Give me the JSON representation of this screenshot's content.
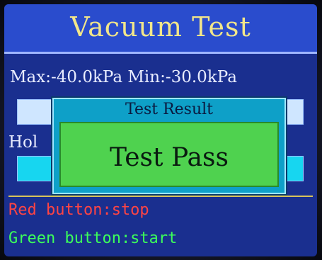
{
  "header": {
    "title": "Vacuum Test"
  },
  "readout": {
    "text": "Max:-40.0kPa Min:-30.0kPa"
  },
  "hold": {
    "label": "Hol"
  },
  "hints": {
    "red": "Red button:stop",
    "green": "Green button:start"
  },
  "dialog": {
    "title": "Test Result",
    "message": "Test Pass"
  },
  "colors": {
    "screen": "#1a2f8f",
    "title_bar": "#2a4ccd",
    "title_text": "#f2e68a",
    "dialog_frame": "#0ea0c8",
    "pass_green": "#4fd24f",
    "hint_red": "#ff4444",
    "hint_green": "#3cff5a"
  }
}
